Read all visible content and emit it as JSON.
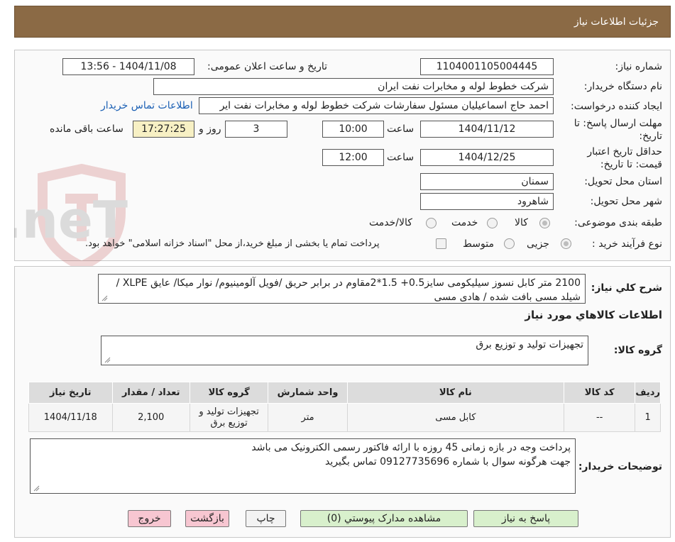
{
  "header": {
    "title": "جزئیات اطلاعات نیاز"
  },
  "form": {
    "need_number_label": "شماره نیاز:",
    "need_number": "1104001105004445",
    "announce_label": "تاریخ و ساعت اعلان عمومی:",
    "announce_value": "1404/11/08 - 13:56",
    "buyer_label": "نام دستگاه خریدار:",
    "buyer_value": "شرکت خطوط لوله و مخابرات نفت ایران",
    "creator_label": "ایجاد کننده درخواست:",
    "creator_value": "احمد  حاج اسماعیلیان مسئول سفارشات  شرکت خطوط لوله و مخابرات نفت ایر",
    "contact_link": "اطلاعات تماس خریدار",
    "deadline_label_1": "مهلت ارسال پاسخ: تا",
    "deadline_label_2": "تاریخ:",
    "deadline_date": "1404/11/12",
    "time_label": "ساعت",
    "deadline_time": "10:00",
    "days_value": "3",
    "days_label": "روز و",
    "remaining_time": "17:27:25",
    "remaining_label": "ساعت باقی مانده",
    "validity_label_1": "حداقل تاریخ اعتبار",
    "validity_label_2": "قیمت: تا تاریخ:",
    "validity_date": "1404/12/25",
    "validity_time": "12:00",
    "province_label": "استان محل تحویل:",
    "province_value": "سمنان",
    "city_label": "شهر محل تحویل:",
    "city_value": "شاهرود",
    "category_label": "طبقه بندی موضوعی:",
    "category_options": [
      "کالا",
      "خدمت",
      "کالا/خدمت"
    ],
    "category_selected": "کالا",
    "process_label": "نوع فرآیند خرید :",
    "process_options": [
      "جزیی",
      "متوسط"
    ],
    "process_selected": "جزیی",
    "payment_note": "پرداخت تمام یا بخشی از مبلغ خرید،از محل \"اسناد خزانه اسلامی\" خواهد بود."
  },
  "watermark": {
    "text": "AriaTender.neT"
  },
  "summary": {
    "label": "شرح کلي نياز:",
    "text": "2100 متر کابل نسوز سیلیکومی سایز0.5+ 1.5*2مقاوم در برابر حریق /فویل آلومینیوم/ نوار میکا/ عایق XLPE / شیلد مسی بافت شده / هادی مسی"
  },
  "goods_section": {
    "title": "اطلاعات کالاهاي مورد نياز",
    "group_label": "گروه کالا:",
    "group_value": "تجهیزات تولید و توزیع برق"
  },
  "table": {
    "headers": [
      "ردیف",
      "کد کالا",
      "نام کالا",
      "واحد شمارش",
      "گروه کالا",
      "تعداد / مقدار",
      "تاریخ نیاز"
    ],
    "rows": [
      [
        "1",
        "--",
        "کابل مسی",
        "متر",
        "تجهیزات تولید و توزیع برق",
        "2,100",
        "1404/11/18"
      ]
    ]
  },
  "buyer_notes": {
    "label": "توضیحات خریدار:",
    "line1": "پرداخت وجه در بازه زمانی 45 روزه با ارائه فاکتور رسمی الکترونیک می باشد",
    "line2": "جهت هرگونه سوال با شماره 09127735696 تماس بگیرید"
  },
  "buttons": {
    "respond": "پاسخ به نیاز",
    "attachments": "مشاهده مدارک پیوستي (0)",
    "print": "چاپ",
    "back": "بازگشت",
    "exit": "خروج"
  },
  "colors": {
    "header_bg": "#8b6a45",
    "green_button": "#d8f0cc",
    "pink_button": "#f7c6d1",
    "remaining_bg": "#f7f0c4",
    "link": "#1a5fb4"
  }
}
